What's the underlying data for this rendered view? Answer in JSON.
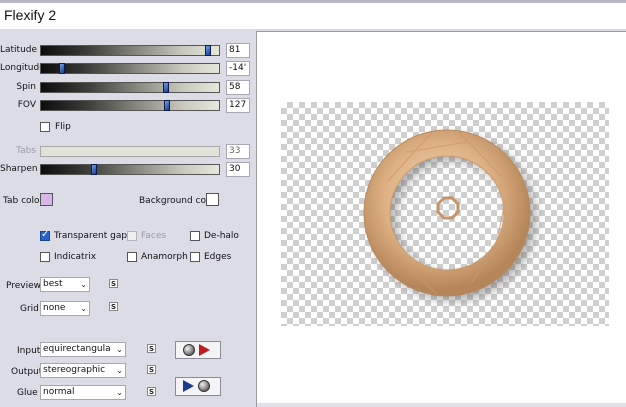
{
  "window": {
    "title": "Flexify 2"
  },
  "sliders": [
    {
      "id": "latitude",
      "label": "Latitude",
      "value": "81",
      "position": 0.94,
      "disabled": false
    },
    {
      "id": "longitude",
      "label": "Longitude",
      "value": "-14'",
      "position": 0.12,
      "disabled": false
    },
    {
      "id": "spin",
      "label": "Spin",
      "value": "58",
      "position": 0.7,
      "disabled": false
    },
    {
      "id": "fov",
      "label": "FOV",
      "value": "127",
      "position": 0.71,
      "disabled": false
    },
    {
      "id": "tabs",
      "label": "Tabs",
      "value": "33",
      "position": 0.0,
      "disabled": true
    },
    {
      "id": "sharpen",
      "label": "Sharpen",
      "value": "30",
      "position": 0.3,
      "disabled": false
    }
  ],
  "flip": {
    "label": "Flip",
    "checked": false
  },
  "colors": {
    "tab_color_label": "Tab color",
    "tab_color": "#d8b6e6",
    "background_color_label": "Background color",
    "background_color": "#ffffff"
  },
  "options": {
    "transparent_gaps": {
      "label": "Transparent gaps",
      "checked": true
    },
    "faces": {
      "label": "Faces",
      "checked": false,
      "disabled": true
    },
    "dehalo": {
      "label": "De-halo",
      "checked": false
    },
    "indicatrix": {
      "label": "Indicatrix",
      "checked": false
    },
    "anamorph": {
      "label": "Anamorph",
      "checked": false
    },
    "edges": {
      "label": "Edges",
      "checked": false
    }
  },
  "preview_select": {
    "label": "Preview",
    "value": "best"
  },
  "grid_select": {
    "label": "Grid",
    "value": "none"
  },
  "input_select": {
    "label": "Input",
    "value": "equirectangula"
  },
  "output_select": {
    "label": "Output",
    "value": "stereographic"
  },
  "glue_select": {
    "label": "Glue",
    "value": "normal"
  },
  "swap_label": "S",
  "accent_color": "#2a64c8",
  "preview_colors": {
    "ring_light": "#f2d6b0",
    "ring_mid": "#dfb285",
    "ring_dark": "#b4865a"
  }
}
